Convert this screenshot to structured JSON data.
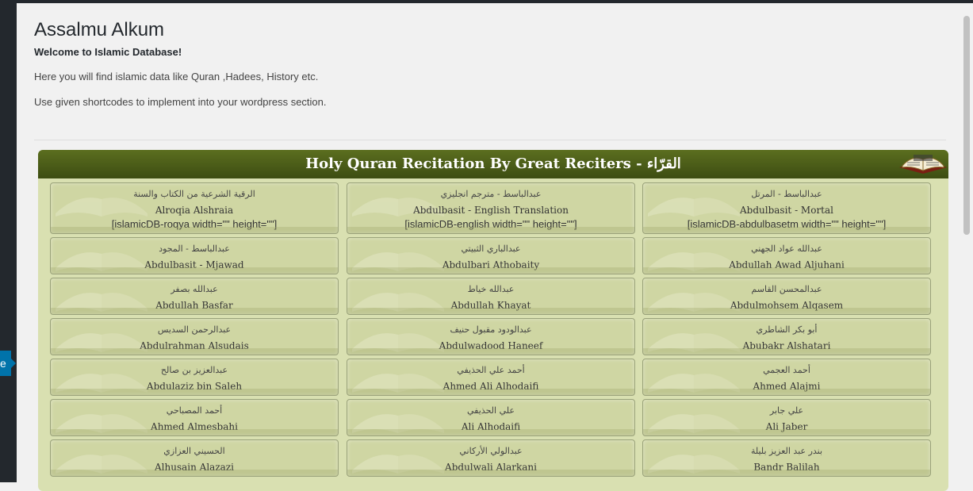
{
  "page": {
    "title": "Assalmu Alkum",
    "welcome": "Welcome to Islamic Database!",
    "intro1": "Here you will find islamic data like Quran ,Hadees, History etc.",
    "intro2": "Use given shortcodes to implement into your wordpress section."
  },
  "sidebar": {
    "collapse_letter": "e"
  },
  "panel": {
    "header": "Holy Quran Recitation By Great Reciters - القرّاء",
    "reciters": [
      {
        "ar": "الرقية الشرعية من الكتاب والسنة",
        "en": "Alroqia Alshraia",
        "shortcode": "[islamicDB-roqya width=\"\" height=\"\"]"
      },
      {
        "ar": "عبدالباسط - مترجم انجليزي",
        "en": "Abdulbasit - English Translation",
        "shortcode": "[islamicDB-english width=\"\" height=\"\"]"
      },
      {
        "ar": "عبدالباسط - المرتل",
        "en": "Abdulbasit - Mortal",
        "shortcode": "[islamicDB-abdulbasetm width=\"\" height=\"\"]"
      },
      {
        "ar": "عبدالباسط - المجود",
        "en": "Abdulbasit - Mjawad"
      },
      {
        "ar": "عبدالباري الثبيتي",
        "en": "Abdulbari Athobaity"
      },
      {
        "ar": "عبدالله عواد الجهني",
        "en": "Abdullah Awad Aljuhani"
      },
      {
        "ar": "عبدالله بصفر",
        "en": "Abdullah Basfar"
      },
      {
        "ar": "عبدالله خياط",
        "en": "Abdullah Khayat"
      },
      {
        "ar": "عبدالمحسن القاسم",
        "en": "Abdulmohsem Alqasem"
      },
      {
        "ar": "عبدالرحمن السديس",
        "en": "Abdulrahman Alsudais"
      },
      {
        "ar": "عبدالودود مقبول حنيف",
        "en": "Abdulwadood Haneef"
      },
      {
        "ar": "أبو بكر الشاطري",
        "en": "Abubakr Alshatari"
      },
      {
        "ar": "عبدالعزيز بن صالح",
        "en": "Abdulaziz bin Saleh"
      },
      {
        "ar": "أحمد علي الحذيفي",
        "en": "Ahmed Ali Alhodaifi"
      },
      {
        "ar": "أحمد العجمي",
        "en": "Ahmed Alajmi"
      },
      {
        "ar": "أحمد المصباحي",
        "en": "Ahmed Almesbahi"
      },
      {
        "ar": "علي الحذيفي",
        "en": "Ali Alhodaifi"
      },
      {
        "ar": "علي جابر",
        "en": "Ali Jaber"
      },
      {
        "ar": "الحسيني العزازي",
        "en": "Alhusain Alazazi"
      },
      {
        "ar": "عبدالولي الأركاني",
        "en": "Abdulwali Alarkani"
      },
      {
        "ar": "بندر عبد العزيز بليلة",
        "en": "Bandr Balilah"
      }
    ]
  },
  "colors": {
    "header_green": "#4b5e19",
    "tile_bg": "#cfd6a3",
    "panel_bg": "#d9e0b1",
    "admin_dark": "#23282d",
    "admin_blue": "#0073aa"
  },
  "icons": {
    "header_icon": "open-quran-book-icon"
  }
}
